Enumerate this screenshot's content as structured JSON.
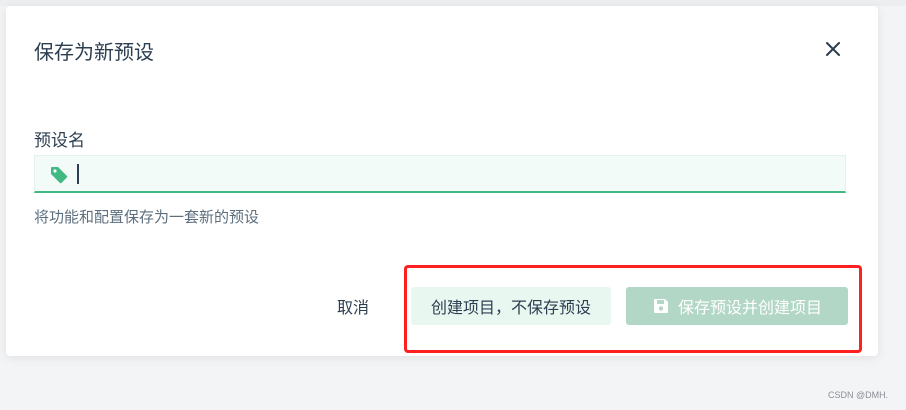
{
  "dialog": {
    "title": "保存为新预设",
    "close_icon": "close-icon"
  },
  "form": {
    "label": "预设名",
    "input_icon": "tag-icon",
    "input_value": "",
    "hint": "将功能和配置保存为一套新的预设"
  },
  "actions": {
    "cancel_label": "取消",
    "create_without_save_label": "创建项目，不保存预设",
    "save_and_create_label": "保存预设并创建项目",
    "save_icon": "floppy-disk-icon"
  },
  "watermark": "CSDN @DMH.",
  "colors": {
    "accent": "#42b983",
    "input_bg": "#f3fbf8",
    "save_button_disabled": "#b2d7c6",
    "highlight_box": "#ff2020"
  }
}
